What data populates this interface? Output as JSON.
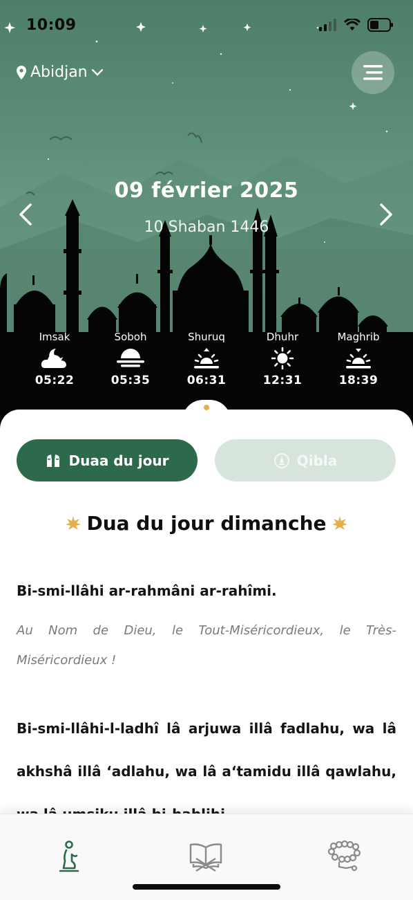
{
  "status_bar": {
    "time": "10:09"
  },
  "header": {
    "location": "Abidjan",
    "date": "09 février 2025",
    "hijri_date": "10 Shaban 1446"
  },
  "prayers": [
    {
      "name": "Imsak",
      "time": "05:22",
      "icon": "cloud-moon-icon"
    },
    {
      "name": "Soboh",
      "time": "05:35",
      "icon": "haze-sun-icon"
    },
    {
      "name": "Shuruq",
      "time": "06:31",
      "icon": "sunrise-icon"
    },
    {
      "name": "Dhuhr",
      "time": "12:31",
      "icon": "sun-icon"
    },
    {
      "name": "Maghrib",
      "time": "18:39",
      "icon": "sunset-icon"
    }
  ],
  "tabs": {
    "duaa_label": "Duaa du jour",
    "qibla_label": "Qibla"
  },
  "dua": {
    "title": "Dua du jour dimanche",
    "line1": "Bi-smi-llâhi ar-rahmâni ar-rahîmi.",
    "translation": "Au Nom de Dieu, le Tout-Miséricordieux, le Très-Miséricordieux !",
    "line2": "Bi-smi-llâhi-l-ladhî lâ arjuwa illâ fadlahu, wa lâ akhshâ illâ ‘adlahu, wa lâ a‘tamidu illâ qawlahu, wa lâ umsiku illâ bi-hablihi."
  },
  "bottom_nav": {
    "items": [
      "prayer-icon",
      "quran-book-icon",
      "tasbih-beads-icon"
    ],
    "active": 0
  },
  "colors": {
    "primary_green": "#2c6a4b",
    "sky_green": "#5f9079",
    "light_green": "#d6e4dc",
    "gold": "#e3b04b"
  }
}
